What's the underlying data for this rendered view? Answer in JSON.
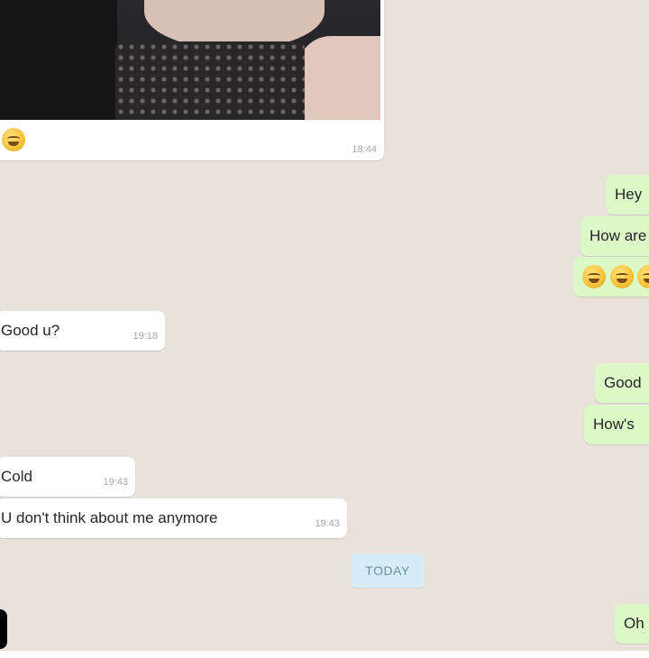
{
  "image_message": {
    "timestamp": "18:44",
    "emoji_icon": "grinning-face-icon"
  },
  "messages": [
    {
      "direction": "out",
      "text": "Hey"
    },
    {
      "direction": "out",
      "text": "How are"
    },
    {
      "direction": "out",
      "emoji_icons": [
        "grinning-face-icon",
        "grinning-face-icon",
        "grinning-face-icon"
      ]
    },
    {
      "direction": "in",
      "text": "Good u?",
      "timestamp": "19:18"
    },
    {
      "direction": "out",
      "text": "Good"
    },
    {
      "direction": "out",
      "text": "How's"
    },
    {
      "direction": "in",
      "text": "Cold",
      "timestamp": "19:43"
    },
    {
      "direction": "in",
      "text": "U don't think about me anymore",
      "timestamp": "19:43"
    },
    {
      "direction": "out",
      "text": "Oh"
    }
  ],
  "date_separator": "TODAY",
  "colors": {
    "chat_background": "#e8e2da",
    "incoming_bubble": "#ffffff",
    "outgoing_bubble": "#dcf8c6",
    "date_chip": "#d6ecf7"
  }
}
